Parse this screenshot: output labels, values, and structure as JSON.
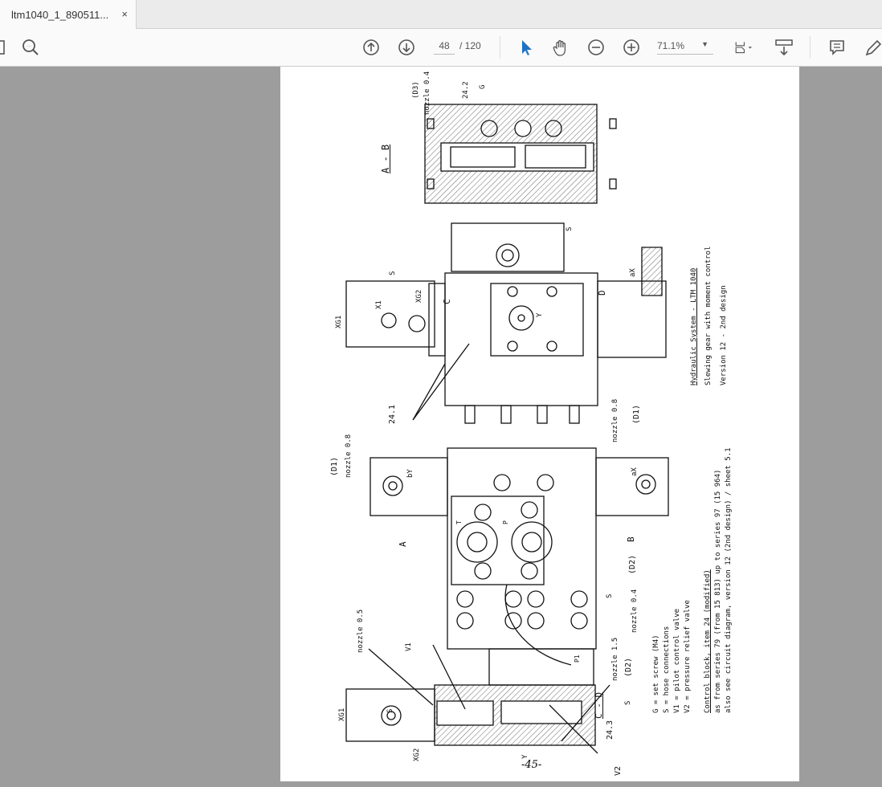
{
  "tab": {
    "title": "ltm1040_1_890511...",
    "close": "×"
  },
  "toolbar": {
    "page_current": "48",
    "page_total": "/ 120",
    "zoom": "71.1%"
  },
  "drawing": {
    "section_ab": "A - B",
    "section_cd": "C - D",
    "labels": {
      "d3": "(D3)",
      "nozzle04_top": "nozzle 0.4",
      "n242": "24.2",
      "g": "G",
      "s_top": "S",
      "s_small": "S",
      "xg1_mid": "XG1",
      "x1": "X1",
      "xg2_mid": "XG2",
      "c": "C",
      "d": "D",
      "y_mid": "Y",
      "ax_mid": "aX",
      "n241": "24.1",
      "nozzle08_mid": "nozzle 0.8",
      "d1_mid": "(D1)",
      "d1_low": "(D1)",
      "nozzle08_low": "nozzle 0.8",
      "by": "bY",
      "ax_low": "aX",
      "t": "T",
      "p": "P",
      "a": "A",
      "b": "B",
      "d2_right": "(D2)",
      "s_low": "S",
      "nozzle04_low": "nozzle 0.4",
      "nozzle15": "nozzle 1.5",
      "d2_low": "(D2)",
      "p1": "P1",
      "s_low2": "S",
      "nozzle05": "nozzle 0.5",
      "v1": "V1",
      "xg1_low": "XG1",
      "s_cd": "S",
      "xg2_low": "XG2",
      "y_low": "Y",
      "n243": "24.3",
      "v2": "V2",
      "page_no": "-45-"
    },
    "title_block": [
      "Hydraulic System - LTM 1040",
      "Slewing gear with moment control",
      "Version 12 - 2nd design"
    ],
    "legend": [
      "G = set screw (M4)",
      "S = hose connections",
      "V1 = pilot control valve",
      "V2 = pressure relief valve"
    ],
    "caption": [
      "Control block, item 24 (modified)",
      "as from series 79 (from 15 813) up to series 97 (15 964)",
      "also see circuit diagram, version 12 (2nd design) / sheet 5.1"
    ]
  }
}
